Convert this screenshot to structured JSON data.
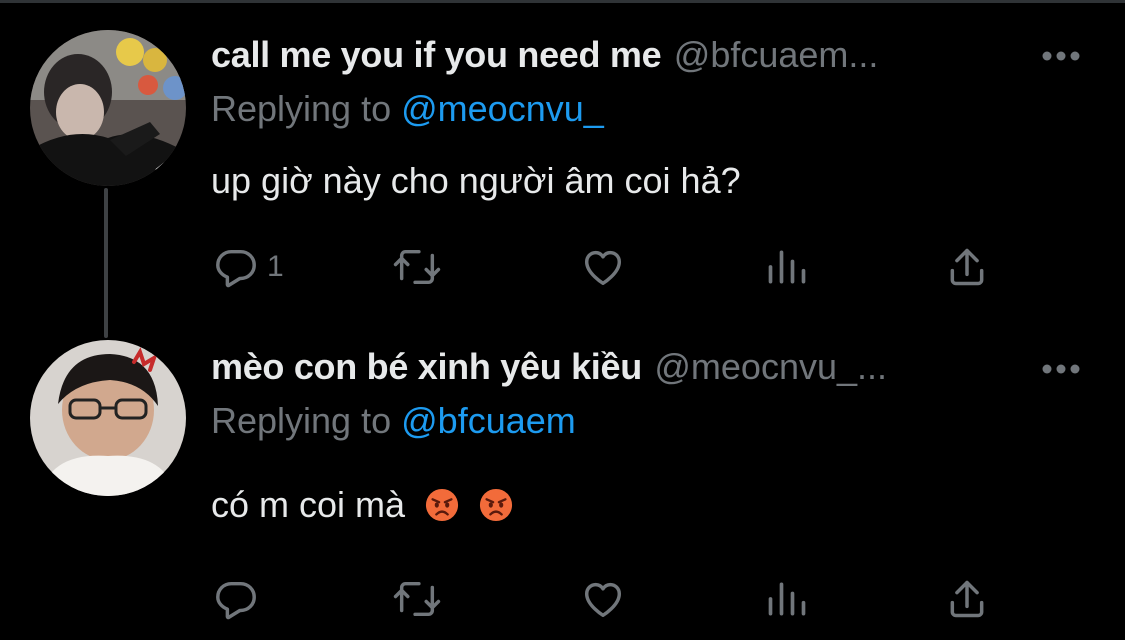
{
  "tweets": [
    {
      "display_name": "call me you if you need me",
      "handle": "@bfcuaem...",
      "replying_prefix": "Replying to",
      "replying_to": "@meocnvu_",
      "text": "up giờ này cho người âm coi hả?",
      "emojis": [],
      "reply_count": "1"
    },
    {
      "display_name": "mèo con bé xinh yêu kiều",
      "handle": "@meocnvu_...",
      "replying_prefix": "Replying to",
      "replying_to": "@bfcuaem",
      "text": "có m coi mà",
      "emojis": [
        "angry-face",
        "angry-face"
      ],
      "reply_count": ""
    }
  ],
  "colors": {
    "background": "#000000",
    "primary_text": "#e7e9ea",
    "secondary_text": "#71767b",
    "mention": "#1d9bf0",
    "thread_line": "#3e4144"
  },
  "icons": [
    "reply-icon",
    "retweet-icon",
    "like-icon",
    "views-icon",
    "share-icon",
    "more-icon"
  ]
}
